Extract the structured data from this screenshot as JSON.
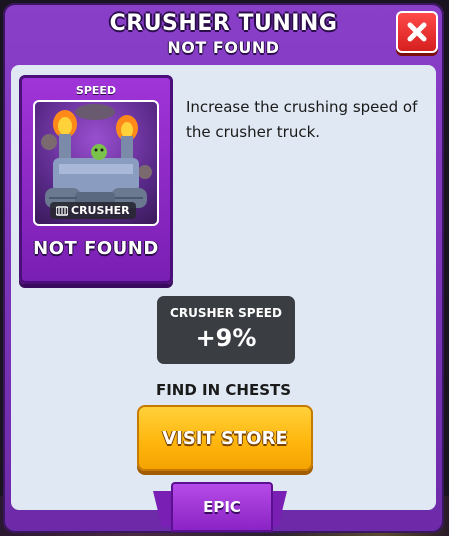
{
  "header": {
    "title": "CRUSHER TUNING",
    "subtitle": "NOT FOUND",
    "close_icon": "close-x-icon"
  },
  "card": {
    "category": "SPEED",
    "truck_name": "CRUSHER",
    "status": "NOT FOUND",
    "rarity": "EPIC"
  },
  "description": "Increase the crushing speed of the crusher truck.",
  "stat": {
    "label": "CRUSHER SPEED",
    "value": "+9%"
  },
  "find_text": "FIND IN CHESTS",
  "store_button": "VISIT STORE",
  "colors": {
    "panel": "#8a3fc9",
    "content_bg": "#dfe8f3",
    "close_red": "#e42a2a",
    "store_yellow": "#ffbd1f",
    "stat_bg": "#3a3d42"
  }
}
